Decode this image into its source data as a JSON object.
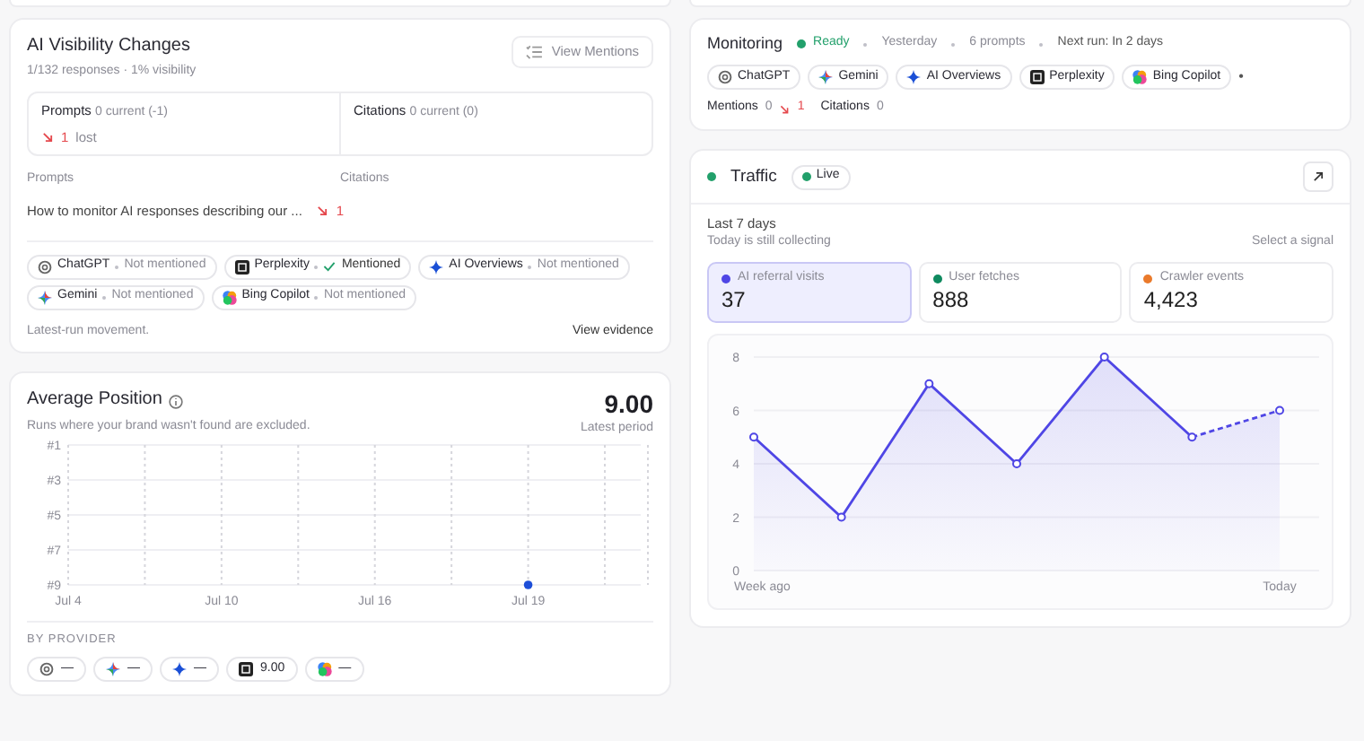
{
  "visibility": {
    "title": "AI Visibility Changes",
    "subtitle": "1/132 responses · 1% visibility",
    "button": "View Mentions",
    "summary": [
      {
        "label": "Prompts",
        "detail": "0 current (-1)",
        "change": "1",
        "change_note": "lost"
      },
      {
        "label": "Citations",
        "detail": "0 current (0)"
      }
    ],
    "columns": [
      "Prompts",
      "Citations"
    ],
    "prompts": [
      {
        "text": "How to monitor AI responses describing our ...",
        "change": "1"
      }
    ],
    "providers": [
      {
        "kind": "chatgpt",
        "name": "ChatGPT",
        "status": "Not mentioned",
        "mentioned": false
      },
      {
        "kind": "perplexity",
        "name": "Perplexity",
        "status": "Mentioned",
        "mentioned": true
      },
      {
        "kind": "overviews",
        "name": "AI Overviews",
        "status": "Not mentioned",
        "mentioned": false
      },
      {
        "kind": "gemini",
        "name": "Gemini",
        "status": "Not mentioned",
        "mentioned": false
      },
      {
        "kind": "copilot",
        "name": "Bing Copilot",
        "status": "Not mentioned",
        "mentioned": false
      }
    ],
    "footer": "Latest-run movement.",
    "link": "View evidence"
  },
  "position": {
    "title": "Average Position",
    "subtitle": "Runs where your brand wasn't found are excluded.",
    "value": "9.00",
    "value_label": "Latest period",
    "chart_data": {
      "type": "scatter",
      "categories": [
        "Jul 4",
        null,
        "Jul 10",
        null,
        "Jul 16",
        null,
        "Jul 19",
        null
      ],
      "series": [
        {
          "color": "#1d4ed8",
          "values": [
            null,
            null,
            null,
            null,
            null,
            null,
            9,
            null
          ]
        }
      ],
      "ylim": [
        9,
        1
      ],
      "grid": true,
      "yticks": [
        {
          "value": 1,
          "label": "#1"
        },
        {
          "value": 3,
          "label": "#3"
        },
        {
          "value": 5,
          "label": "#5"
        },
        {
          "value": 7,
          "label": "#7"
        },
        {
          "value": 9,
          "label": "#9"
        }
      ]
    },
    "by_provider_label": "BY PROVIDER",
    "providers": [
      {
        "kind": "chatgpt",
        "value": "—"
      },
      {
        "kind": "gemini",
        "value": "—"
      },
      {
        "kind": "overviews",
        "value": "—"
      },
      {
        "kind": "perplexity",
        "value": "9.00"
      },
      {
        "kind": "copilot",
        "value": "—"
      }
    ]
  },
  "monitoring": {
    "title": "Monitoring",
    "status": "Ready",
    "meta": [
      "Yesterday",
      "6 prompts",
      "Next run: In 2 days"
    ],
    "providers": [
      {
        "kind": "chatgpt",
        "name": "ChatGPT"
      },
      {
        "kind": "gemini",
        "name": "Gemini"
      },
      {
        "kind": "overviews",
        "name": "AI Overviews"
      },
      {
        "kind": "perplexity",
        "name": "Perplexity"
      },
      {
        "kind": "copilot",
        "name": "Bing Copilot"
      }
    ],
    "more": "•",
    "stats": [
      {
        "label": "Mentions",
        "value": "0",
        "change": "1"
      },
      {
        "label": "Citations",
        "value": "0"
      }
    ]
  },
  "traffic": {
    "title": "Traffic",
    "badge": "Live",
    "period": "Last 7 days",
    "note": "Today is still collecting",
    "hint": "Select a signal",
    "metrics": [
      {
        "label": "AI referral visits",
        "value": "37",
        "color": "#4f46e5",
        "selected": true
      },
      {
        "label": "User fetches",
        "value": "888",
        "color": "#0f8a5f",
        "selected": false
      },
      {
        "label": "Crawler events",
        "value": "4,423",
        "color": "#ea7a2b",
        "selected": false
      }
    ],
    "incomplete_last": true,
    "chart_data": {
      "type": "area",
      "categories": [
        "Week ago",
        null,
        null,
        null,
        null,
        null,
        "Today"
      ],
      "series": [
        {
          "color": "#4f46e5",
          "values": [
            5,
            2,
            7,
            4,
            8,
            5,
            6
          ]
        }
      ],
      "ylim": [
        0,
        8
      ],
      "yticks": [
        0,
        2,
        4,
        6,
        8
      ],
      "grid": true
    }
  }
}
